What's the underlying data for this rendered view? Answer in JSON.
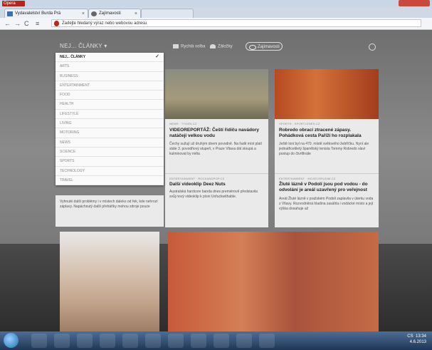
{
  "browser": {
    "menu_label": "Opera",
    "tabs": [
      {
        "label": "Vydavatelství Burda Prá"
      },
      {
        "label": "Zajímavosti"
      }
    ],
    "address_placeholder": "Zadejte hledaný výraz nebo webovou adresu"
  },
  "header": {
    "category_label": "NEJ... ČLÁNKY ▾",
    "buttons": [
      "Rychlá volba",
      "Záložky",
      "Zajímavosti"
    ]
  },
  "dropdown": {
    "items": [
      "NEJ... ČLÁNKY",
      "ARTS",
      "BUSINESS",
      "ENTERTAINMENT",
      "FOOD",
      "HEALTH",
      "LIFESTYLE",
      "LIVING",
      "MOTORING",
      "NEWS",
      "SCIENCE",
      "SPORTS",
      "TECHNOLOGY",
      "TRAVEL"
    ],
    "selected": "NEJ... ČLÁNKY"
  },
  "cards": [
    {
      "source": "NEWS · TYDEN.CZ",
      "title": "VIDEOREPORTÁŽ: Čeští řidiču navádory natáčejí velkou vodu",
      "snippet": "Čechy sužují už druhým dnem povodně. Na řadě míst platí stále 3. povodňový stupeň, v Praze Vltava dál stoupá a kulminovat by měla"
    },
    {
      "source": "SPORTS · SPORT.IDNES.CZ",
      "title": "Robredo obrací ztracené zápasy. Pohádková cesta Paříží ho rozplakala",
      "snippet": "Ještě loni byl na 470. místě světového žebříčku. Nyní ale jednatřicetiletý španělský tenista Tommy Robredo slaví postup do čtvrtfinále"
    },
    {
      "source": "ENTERTAINMENT · ROCKANDPOP.CZ",
      "title": "Další videoklip Deez Nuts",
      "snippet": "Australská hardcore banda dnes premiérově představila svůj nový videoklip k písni Unfuckwithable."
    },
    {
      "source": "ENTERTAINMENT · MOJECHRUDIM.CZ",
      "title": "Žluté lázně v Podolí jsou pod vodou - do odvolání je areál uzavřený pro veřejnost",
      "snippet": "Areál Žluté lázně v pražském Podolí zaplavila v úterku voda z Vltavy. Rozvodněná hladina zasáhla i vodácké místo a její výška dosahuje až"
    },
    {
      "snippet": "Vyhnuté další problémy i v místech daleko od řek, kde nehrozí záplavy. Napáchnutý další přeháňky mohou zdroje pouze"
    }
  ],
  "taskbar": {
    "tray_lang": "CS",
    "time": "13:34",
    "date": "4.6.2013"
  },
  "colors": {
    "opera_red": "#c0231b",
    "taskbar": "#1f3656",
    "page_bg": "#7a7a7a"
  }
}
